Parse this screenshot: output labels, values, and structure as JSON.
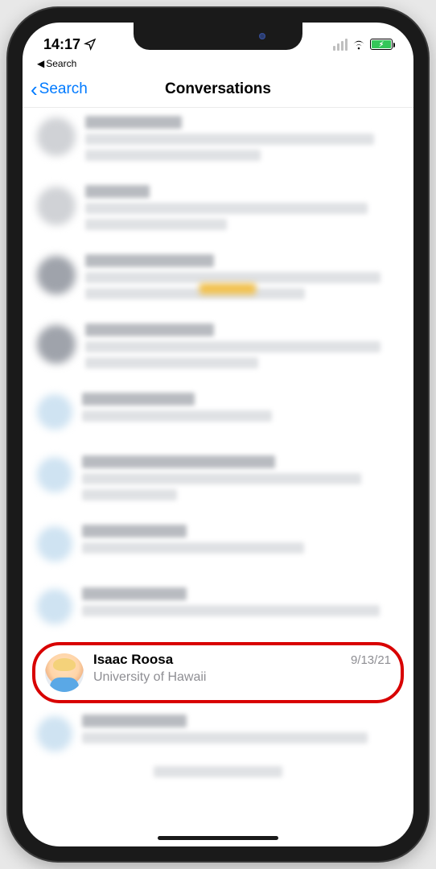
{
  "status": {
    "time": "14:17",
    "location_icon": "◤",
    "breadcrumb_back_label": "Search"
  },
  "nav": {
    "back_label": "Search",
    "title": "Conversations"
  },
  "highlighted_conversation": {
    "name": "Isaac Roosa",
    "preview": "University of Hawaii",
    "date": "9/13/21"
  }
}
